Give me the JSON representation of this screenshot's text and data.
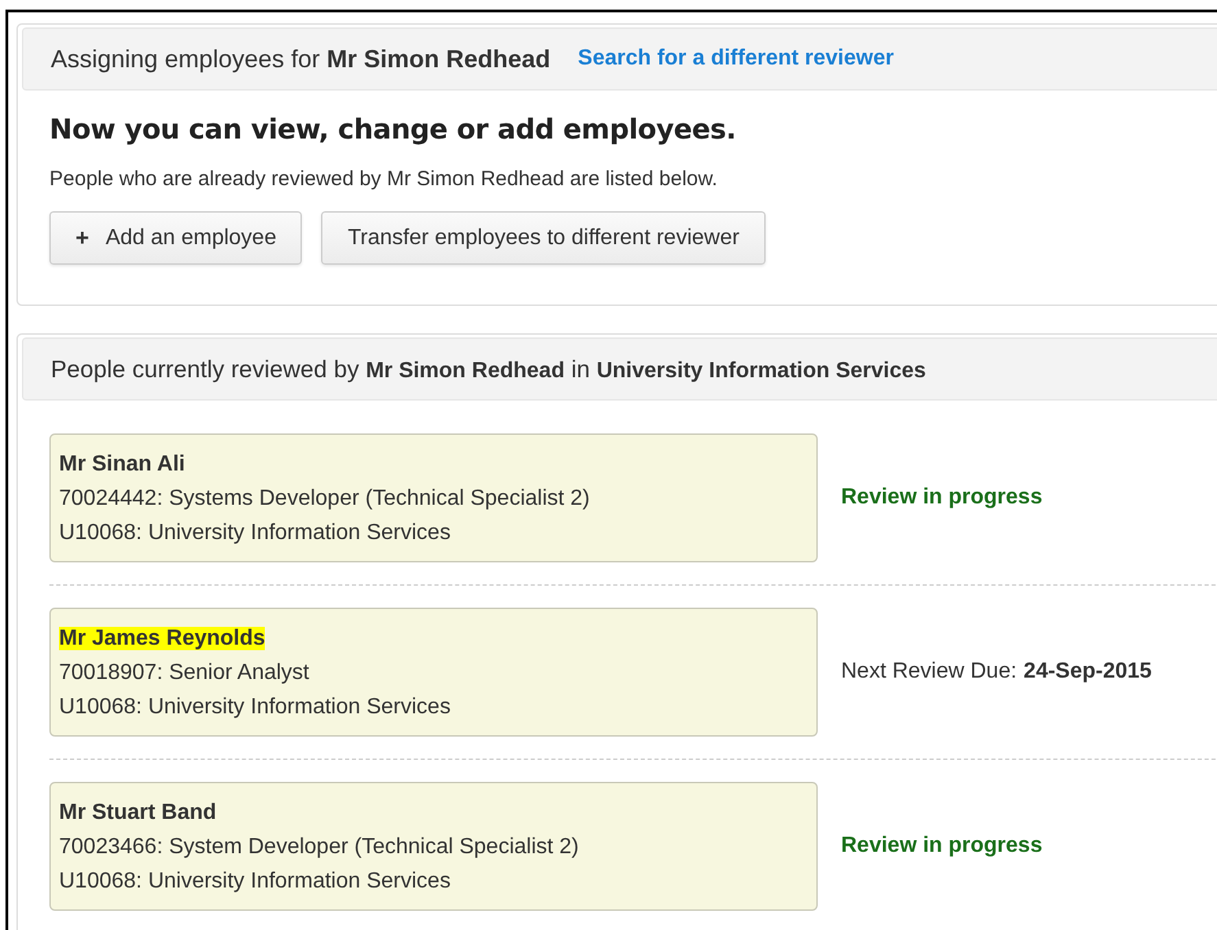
{
  "assign_panel": {
    "heading": "Assigning employees for **Mr Simon Redhead**",
    "heading_link": "Search for a different reviewer",
    "title": "Now you can view, change or add employees.",
    "description": "People who are already reviewed by Mr Simon Redhead are listed below.",
    "buttons": [
      {
        "label": "Add an employee",
        "icon": "+"
      },
      {
        "label": "Transfer employees to different reviewer"
      }
    ]
  },
  "people_panel": {
    "heading": "People currently reviewed by **Mr Simon Redhead** in **University Information Services**",
    "employees": [
      {
        "name": "Mr Sinan Ali",
        "highlighted": false,
        "post": "70024442: Systems Developer (Technical Specialist 2)",
        "institution": "U10068: University Information Services",
        "status": {
          "kind": "in_progress",
          "text": "Review in progress"
        }
      },
      {
        "name": "Mr James Reynolds",
        "highlighted": true,
        "post": "70018907: Senior Analyst",
        "institution": "U10068: University Information Services",
        "status": {
          "kind": "due",
          "label": "Next Review Due:",
          "date": "24-Sep-2015"
        }
      },
      {
        "name": "Mr Stuart Band",
        "highlighted": false,
        "post": "70023466: System Developer (Technical Specialist 2)",
        "institution": "U10068: University Information Services",
        "status": {
          "kind": "in_progress",
          "text": "Review in progress"
        }
      }
    ]
  }
}
